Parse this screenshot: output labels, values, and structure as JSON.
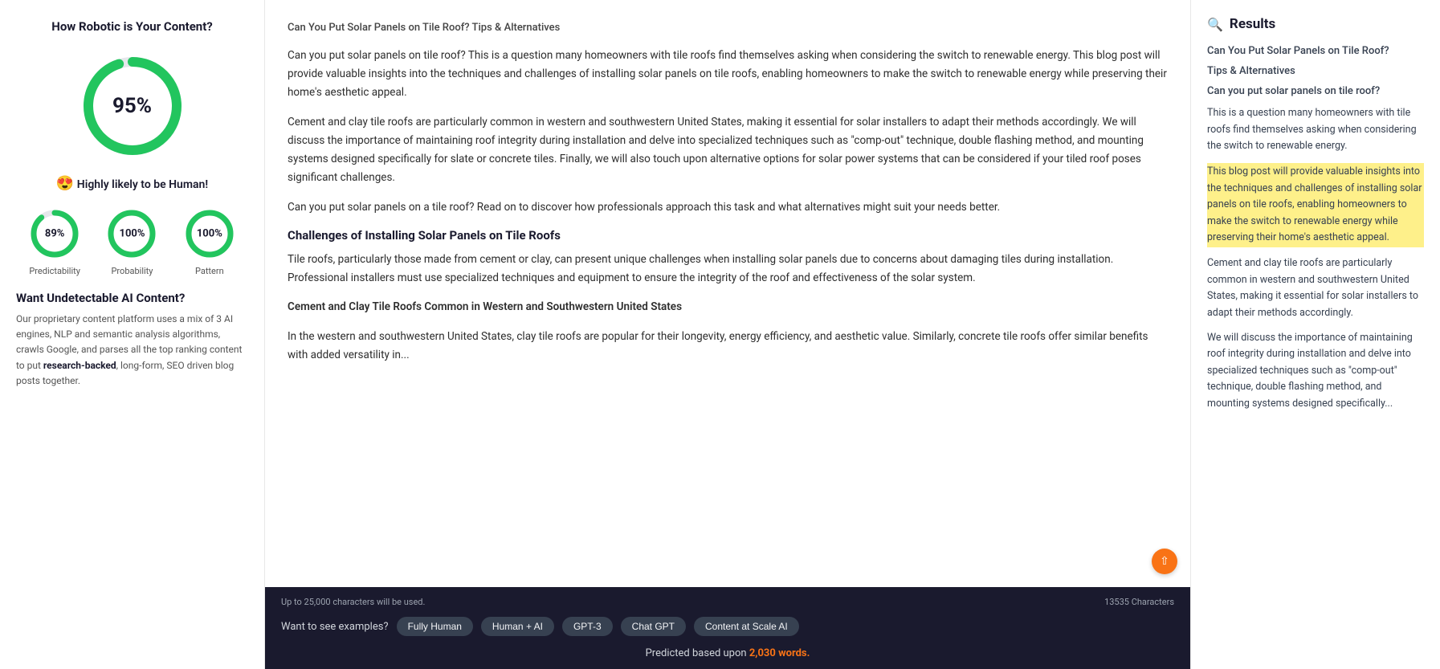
{
  "left": {
    "title": "How Robotic is Your Content?",
    "main_percent": "95%",
    "badge_emoji": "😍",
    "badge_text": "Highly likely to be Human!",
    "circles": [
      {
        "label": "Predictability",
        "value": "89%",
        "percent": 89,
        "color": "#22c55e",
        "bg": "#e5e7eb"
      },
      {
        "label": "Probability",
        "value": "100%",
        "percent": 100,
        "color": "#22c55e",
        "bg": "#e5e7eb"
      },
      {
        "label": "Pattern",
        "value": "100%",
        "percent": 100,
        "color": "#22c55e",
        "bg": "#e5e7eb"
      }
    ],
    "undetectable_title": "Want Undetectable AI Content?",
    "undetectable_desc": "Our proprietary content platform uses a mix of 3 AI engines, NLP and semantic analysis algorithms, crawls Google, and parses all the top ranking content to put ",
    "undetectable_bold": "research-backed",
    "undetectable_desc2": ", long-form, SEO driven blog posts together."
  },
  "center": {
    "title": "Can You Put Solar Panels on Tile Roof? Tips & Alternatives",
    "paragraphs": [
      "Can you put solar panels on tile roof? This is a question many homeowners with tile roofs find themselves asking when considering the switch to renewable energy. This blog post will provide valuable insights into the techniques and challenges of installing solar panels on tile roofs, enabling homeowners to make the switch to renewable energy while preserving their home's aesthetic appeal.",
      "Cement and clay tile roofs are particularly common in western and southwestern United States, making it essential for solar installers to adapt their methods accordingly. We will discuss the importance of maintaining roof integrity during installation and delve into specialized techniques such as \"comp-out\" technique, double flashing method, and mounting systems designed specifically for slate or concrete tiles. Finally, we will also touch upon alternative options for solar power systems that can be considered if your tiled roof poses significant challenges.",
      "Can you put solar panels on a tile roof? Read on to discover how professionals approach this task and what alternatives might suit your needs better."
    ],
    "section_title": "Challenges of Installing Solar Panels on Tile Roofs",
    "section_paragraphs": [
      "Tile roofs, particularly those made from cement or clay, can present unique challenges when installing solar panels due to concerns about damaging tiles during installation. Professional installers must use specialized techniques and equipment to ensure the integrity of the roof and effectiveness of the solar system.",
      "Cement and Clay Tile Roofs Common in Western and Southwestern United States",
      "In the western and southwestern United States, clay tile roofs are popular for their longevity, energy efficiency, and aesthetic value. Similarly, concrete tile roofs offer similar benefits with added versatility in..."
    ],
    "footer": {
      "char_note": "Up to 25,000 characters will be used.",
      "char_count": "13535 Characters",
      "examples_label": "Want to see examples?",
      "tags": [
        "Fully Human",
        "Human + AI",
        "GPT-3",
        "Chat GPT",
        "Content at Scale AI"
      ],
      "predicted_text": "Predicted based upon ",
      "predicted_words": "2,030 words.",
      "predicted_words_color": "#f97316"
    }
  },
  "right": {
    "results_label": "Results",
    "links": [
      "Can You Put Solar Panels on Tile Roof?",
      "Tips & Alternatives",
      "Can you put solar panels on tile roof?"
    ],
    "paragraph1": "This is a question many homeowners with tile roofs find themselves asking when considering the switch to renewable energy.",
    "highlighted": "This blog post will provide valuable insights into the techniques and challenges of installing solar panels on tile roofs, enabling homeowners to make the switch to renewable energy while preserving their home's aesthetic appeal.",
    "paragraph2": "Cement and clay tile roofs are particularly common in western and southwestern United States, making it essential for solar installers to adapt their methods accordingly.",
    "paragraph3": "We will discuss the importance of maintaining roof integrity during installation and delve into specialized techniques such as \"comp-out\" technique, double flashing method, and mounting systems designed specifically..."
  }
}
